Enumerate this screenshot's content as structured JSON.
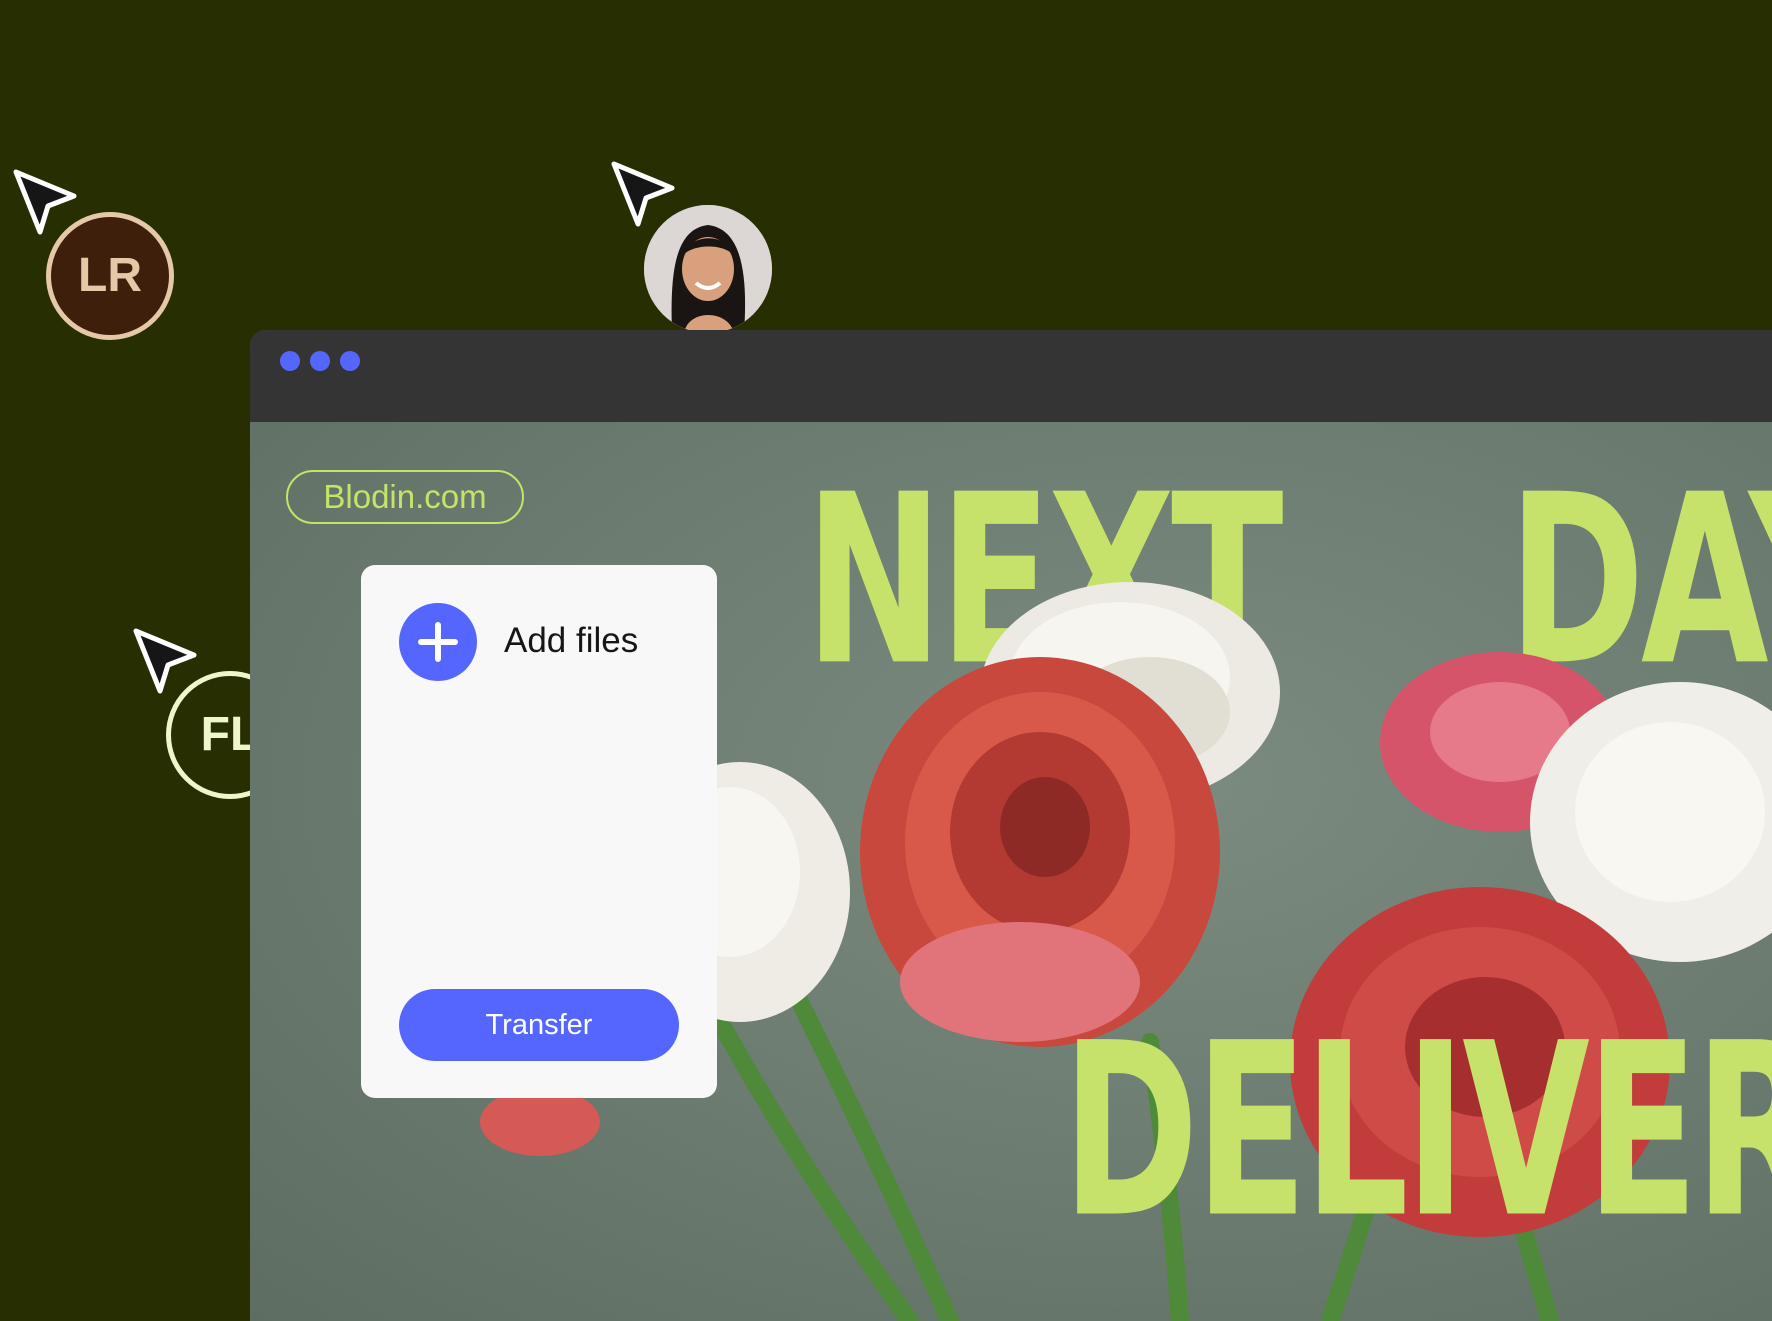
{
  "colors": {
    "page_bg": "#272f02",
    "accent_lime": "#c6e26a",
    "button_blue": "#5566ff",
    "titlebar": "#343434"
  },
  "browser": {
    "window_controls": [
      "dot",
      "dot",
      "dot"
    ],
    "url": "Blodin.com"
  },
  "hero": {
    "headline_word_1": "NEXT",
    "headline_word_2": "DAY",
    "headline_word_3": "DELIVERY"
  },
  "upload_panel": {
    "add_icon": "plus-icon",
    "add_label": "Add files",
    "transfer_label": "Transfer"
  },
  "collaborators": [
    {
      "initials": "LR",
      "icon": "cursor-arrow-icon"
    },
    {
      "initials": "",
      "icon": "cursor-arrow-icon"
    },
    {
      "initials": "FL",
      "icon": "cursor-arrow-icon"
    }
  ]
}
